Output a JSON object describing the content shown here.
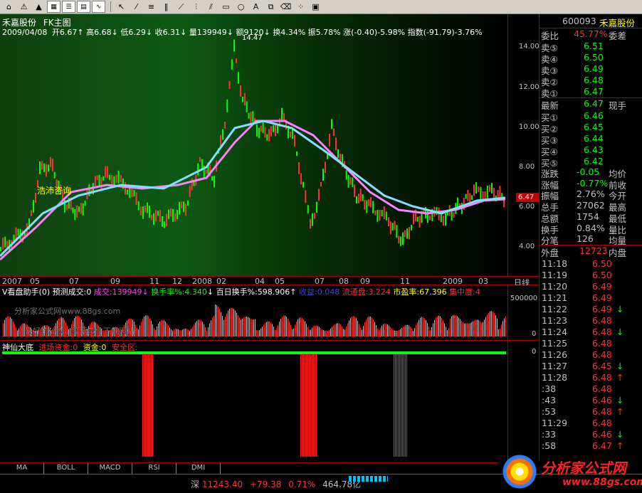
{
  "stock": {
    "title": "禾嘉股份",
    "subtitle": "FK主图",
    "date": "2009/04/08",
    "open_label": "开",
    "open": "6.67",
    "high_label": "高",
    "high": "6.68",
    "low_label": "低",
    "low": "6.29",
    "close_label": "收",
    "close": "6.31",
    "vol_label": "量",
    "vol": "139949",
    "amount_label": "额",
    "amount": "9120",
    "turnover_label": "换",
    "turnover": "4.34%",
    "swing_label": "振",
    "swing": "5.78%",
    "change_label": "涨",
    "change": "(-0.40)-5.98%",
    "index_label": "指数",
    "index": "(-91.79)-3.76%",
    "peak_label": "14.47",
    "watermark": "浩沛咨询",
    "price_tag": "6.47"
  },
  "price_axis": [
    "14.00",
    "12.00",
    "10.00",
    "8.00",
    "6.00",
    "4.00"
  ],
  "date_axis": [
    "2007",
    "05",
    "07",
    "09",
    "11",
    "12",
    "2008",
    "02",
    "04",
    "05",
    "07",
    "08",
    "09",
    "11",
    "2009",
    "03"
  ],
  "date_axis_right": "日线",
  "volume_panel": {
    "name": "V看盘助手(0)",
    "predict": "预测成交:0",
    "vol": "成交:139949",
    "turnover": "换手率%:4.340",
    "hundred": "百日换手%:598.906",
    "income": "收益:0.048",
    "float": "流通盘:3.224",
    "pe": "市盈率:67.396",
    "concentrate": "集中度:4",
    "axis_top": "500000",
    "axis_bottom": "0",
    "watermark1": "分析家公式网www.88gs.com",
    "watermark2": "最好的公式、股票软件下载网站"
  },
  "indicator_panel": {
    "name": "神仙大底",
    "capital": "进场资金:0",
    "funds": "资金:0",
    "safe": "安全区:",
    "axis_zero": "0"
  },
  "right_panel": {
    "code": "600093",
    "name": "禾嘉股份",
    "ratio_label": "委比",
    "ratio": "45.77%",
    "diff_label": "委差",
    "sells": [
      {
        "label": "卖⑤",
        "price": "6.51"
      },
      {
        "label": "卖④",
        "price": "6.50"
      },
      {
        "label": "卖③",
        "price": "6.49"
      },
      {
        "label": "卖②",
        "price": "6.48"
      },
      {
        "label": "卖①",
        "price": "6.47"
      }
    ],
    "latest_label": "最新",
    "latest": "6.47",
    "current_hand_label": "现手",
    "buys": [
      {
        "label": "买①",
        "price": "6.46"
      },
      {
        "label": "买②",
        "price": "6.45"
      },
      {
        "label": "买③",
        "price": "6.44"
      },
      {
        "label": "买④",
        "price": "6.43"
      },
      {
        "label": "买⑤",
        "price": "6.42"
      }
    ],
    "stats": [
      {
        "l1": "涨跌",
        "v": "-0.05",
        "l2": "均价"
      },
      {
        "l1": "涨幅",
        "v": "-0.77%",
        "l2": "前收"
      },
      {
        "l1": "振幅",
        "v": "2.76%",
        "l2": "今开"
      },
      {
        "l1": "总手",
        "v": "27062",
        "l2": "最高"
      },
      {
        "l1": "总额",
        "v": "1754",
        "l2": "最低"
      },
      {
        "l1": "换手",
        "v": "0.84%",
        "l2": "量比"
      },
      {
        "l1": "分笔",
        "v": "126",
        "l2": "均量"
      }
    ],
    "outer_label": "外盘",
    "outer": "12723",
    "inner_label": "内盘",
    "ticks": [
      {
        "t": "11:18",
        "p": "6.50",
        "a": ""
      },
      {
        "t": "11:19",
        "p": "6.50",
        "a": ""
      },
      {
        "t": "11:20",
        "p": "6.49",
        "a": ""
      },
      {
        "t": "11:21",
        "p": "6.49",
        "a": ""
      },
      {
        "t": "11:22",
        "p": "6.49",
        "a": "↓"
      },
      {
        "t": "11:23",
        "p": "6.48",
        "a": ""
      },
      {
        "t": "11:24",
        "p": "6.48",
        "a": "↓"
      },
      {
        "t": "11:25",
        "p": "6.48",
        "a": ""
      },
      {
        "t": "11:26",
        "p": "6.48",
        "a": ""
      },
      {
        "t": "11:27",
        "p": "6.45",
        "a": "↓"
      },
      {
        "t": "11:28",
        "p": "6.48",
        "a": "↑"
      },
      {
        "t": ":38",
        "p": "6.48",
        "a": ""
      },
      {
        "t": ":43",
        "p": "6.46",
        "a": "↓"
      },
      {
        "t": ":53",
        "p": "6.48",
        "a": "↑"
      },
      {
        "t": "11:29",
        "p": "6.48",
        "a": ""
      },
      {
        "t": ":33",
        "p": "6.46",
        "a": "↓"
      },
      {
        "t": ":58",
        "p": "6.47",
        "a": "↑"
      }
    ]
  },
  "tabs": [
    "MA",
    "BOLL",
    "MACD",
    "RSI",
    "DMI"
  ],
  "status": {
    "market": "深",
    "index": "11243.40",
    "change": "+79.38",
    "pct": "0.71%",
    "amount": "464.78亿",
    "logo": "分析家公式网",
    "logo_url": "www.88gs.com"
  },
  "colors": {
    "up": "#ff3232",
    "down": "#00e000",
    "yellow": "#ffff00",
    "cyan": "#00c0c0",
    "magenta": "#ff00ff",
    "axis_red": "#c00000"
  }
}
